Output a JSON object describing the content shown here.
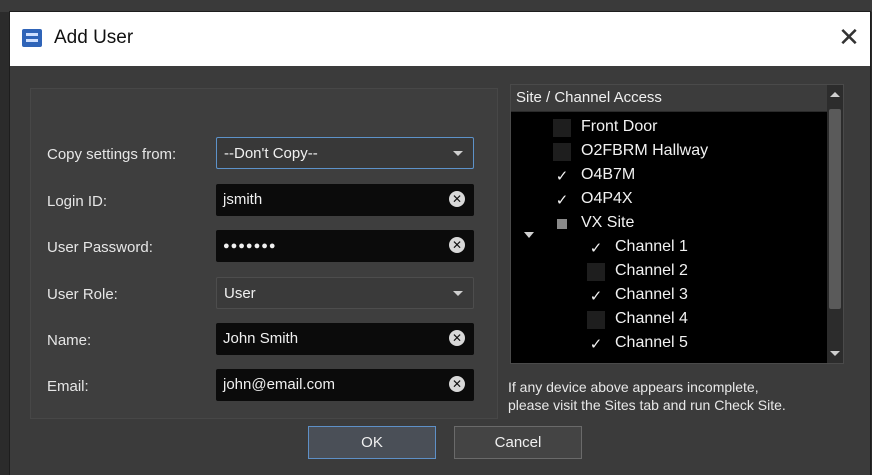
{
  "dialog": {
    "title": "Add User",
    "close_glyph": "✕"
  },
  "form": {
    "copy_label": "Copy settings from:",
    "copy_value": "--Don't Copy--",
    "login_label": "Login ID:",
    "login_value": "jsmith",
    "password_label": "User Password:",
    "password_value": "●●●●●●●",
    "role_label": "User Role:",
    "role_value": "User",
    "name_label": "Name:",
    "name_value": "John Smith",
    "email_label": "Email:",
    "email_value": "john@email.com",
    "clear_glyph": "✕"
  },
  "tree": {
    "header": "Site / Channel Access",
    "check_glyph": "✓",
    "items": [
      {
        "label": "Front Door",
        "checked": false
      },
      {
        "label": "O2FBRM Hallway",
        "checked": false
      },
      {
        "label": "O4B7M",
        "checked": true
      },
      {
        "label": "O4P4X",
        "checked": true
      },
      {
        "label": "VX Site",
        "checked": "partial"
      },
      {
        "label": "Channel 1",
        "checked": true
      },
      {
        "label": "Channel 2",
        "checked": false
      },
      {
        "label": "Channel 3",
        "checked": true
      },
      {
        "label": "Channel 4",
        "checked": false
      },
      {
        "label": "Channel 5",
        "checked": true
      }
    ]
  },
  "note": {
    "line1": "If any device above appears incomplete,",
    "line2": "please visit the Sites tab and run Check Site."
  },
  "buttons": {
    "ok": "OK",
    "cancel": "Cancel"
  },
  "colors": {
    "accent": "#5e90c7",
    "background": "#3b3b3b",
    "field": "#0b0b0b"
  }
}
